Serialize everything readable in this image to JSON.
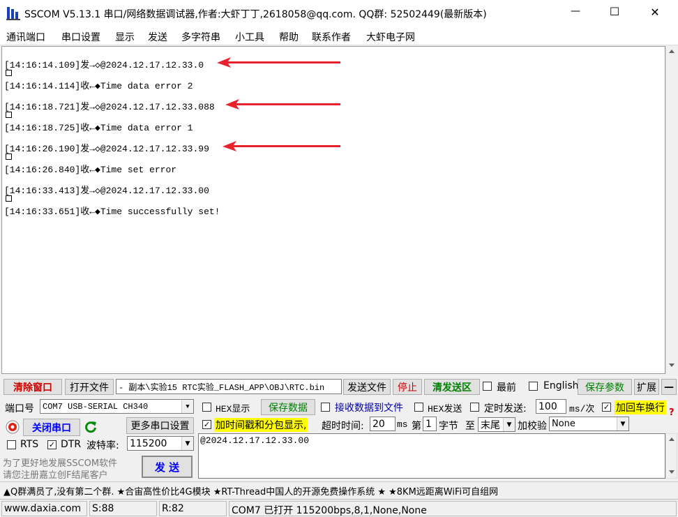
{
  "window": {
    "title": "SSCOM V5.13.1 串口/网络数据调试器,作者:大虾丁丁,2618058@qq.com. QQ群: 52502449(最新版本)",
    "minimize": "—",
    "maximize": "☐",
    "close": "✕"
  },
  "menu": [
    "通讯端口",
    "串口设置",
    "显示",
    "发送",
    "多字符串",
    "小工具",
    "帮助",
    "联系作者",
    "大虾电子网"
  ],
  "log": [
    {
      "text": "[14:16:14.109]发→◇@2024.12.17.12.33.0",
      "box": true
    },
    {
      "text": "[14:16:14.114]收←◆Time data error 2",
      "box": false
    },
    {
      "text": "[14:16:18.721]发→◇@2024.12.17.12.33.088",
      "box": true
    },
    {
      "text": "[14:16:18.725]收←◆Time data error 1",
      "box": false
    },
    {
      "text": "[14:16:26.190]发→◇@2024.12.17.12.33.99",
      "box": true
    },
    {
      "text": "[14:16:26.840]收←◆Time set error",
      "box": false
    },
    {
      "text": "[14:16:33.413]发→◇@2024.12.17.12.33.00",
      "box": true
    },
    {
      "text": "[14:16:33.651]收←◆Time successfully set!",
      "box": false
    }
  ],
  "toolbar": {
    "clear": "清除窗口",
    "open_file": "打开文件",
    "file_path": "- 副本\\实验15 RTC实验_FLASH_APP\\OBJ\\RTC.bin",
    "send_file": "发送文件",
    "stop": "停止",
    "clear_send": "清发送区",
    "topmost": "最前",
    "english": "English",
    "save_params": "保存参数",
    "expand": "扩展",
    "collapse": "—"
  },
  "port": {
    "label": "端口号",
    "value": "COM7 USB-SERIAL CH340",
    "close_port": "关闭串口",
    "more_settings": "更多串口设置",
    "rts": "RTS",
    "dtr": "DTR",
    "baud_label": "波特率:",
    "baud": "115200"
  },
  "options": {
    "hex_display": "HEX显示",
    "save_data": "保存数据",
    "recv_to_file": "接收数据到文件",
    "hex_send": "HEX发送",
    "timed_send": "定时发送:",
    "interval": "100",
    "interval_unit": "ms/次",
    "add_crlf": "加回车换行",
    "timestamp": "加时间戳和分包显示,",
    "timeout_label": "超时时间:",
    "timeout": "20",
    "ms": "ms",
    "nth": "第",
    "byte_pos": "1",
    "byte_label": "字节",
    "to": "至",
    "end": "末尾",
    "checksum_label": "加校验",
    "checksum": "None",
    "help": "?"
  },
  "promo": {
    "line1": "为了更好地发展SSCOM软件",
    "line2": "请您注册嘉立创F结尾客户"
  },
  "send": {
    "button": "发 送",
    "text": "@2024.12.17.12.33.00"
  },
  "ticker": "▲Q群满员了,没有第二个群. ★合宙高性价比4G模块 ★RT-Thread中国人的开源免费操作系统 ★ ★8KM远距离WiFi可自组网",
  "status": {
    "site": "www.daxia.com",
    "sent": "S:88",
    "recv": "R:82",
    "port_status": "COM7 已打开  115200bps,8,1,None,None"
  },
  "colors": {
    "accent": "#0000ff",
    "highlight": "#ffff00",
    "green": "#008000",
    "red": "#cc0000",
    "arrow": "#e8212b"
  }
}
